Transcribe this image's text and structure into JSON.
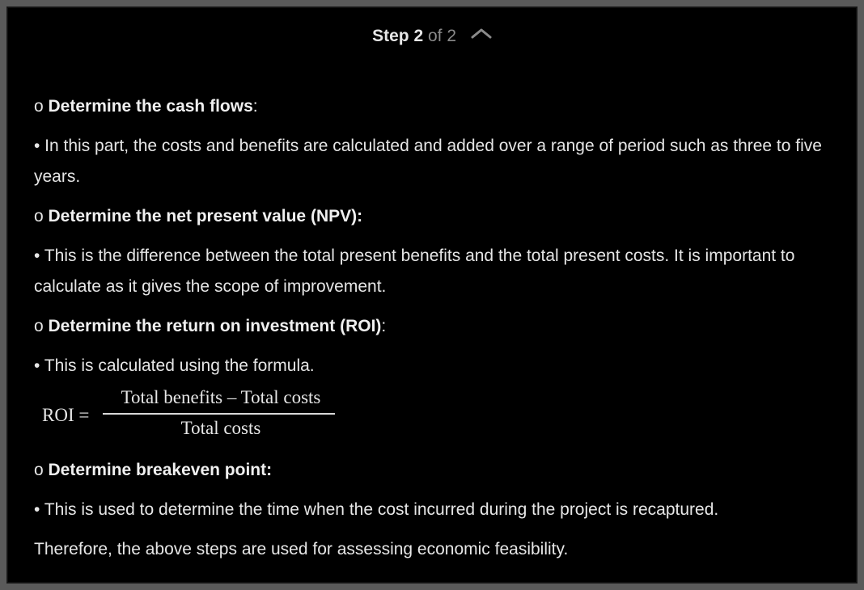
{
  "header": {
    "step_label": "Step 2",
    "of_label": "of 2",
    "collapse_icon": "chevron-up-icon"
  },
  "content": {
    "p1_bullet": "o ",
    "p1_bold": "Determine the cash flows",
    "p1_tail": ":",
    "p2": "• In this part, the costs and benefits are calculated and added over a range of period such as three to five years.",
    "p3_bullet": "o ",
    "p3_bold": "Determine the net present value (NPV):",
    "p4": "• This is the difference between the total present benefits and the total present costs. It is important to calculate as it gives the scope of improvement.",
    "p5_bullet": "o ",
    "p5_bold": "Determine the return on investment (ROI)",
    "p5_tail": ":",
    "p6": "• This is calculated using the formula.",
    "formula": {
      "lhs": "ROI =",
      "numerator": "Total benefits – Total costs",
      "denominator": "Total costs"
    },
    "p7_bullet": "o ",
    "p7_bold": "Determine breakeven point:",
    "p8": "• This is used to determine the time when the cost incurred during the project is recaptured.",
    "p9": "Therefore, the above steps are used for assessing economic feasibility."
  },
  "colors": {
    "background": "#000000",
    "text": "#e6e6e6",
    "muted": "#8a8a8a",
    "frame": "#5a5a5a"
  }
}
